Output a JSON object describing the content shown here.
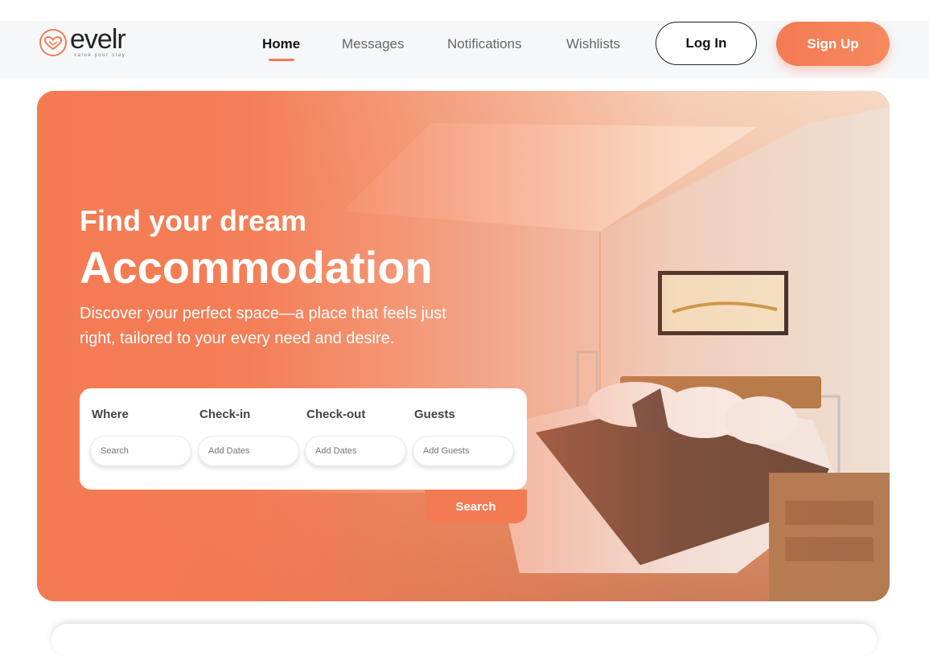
{
  "brand": {
    "name": "evelr",
    "tagline": "value your stay",
    "accent_color": "#f47a52"
  },
  "nav": {
    "items": [
      {
        "label": "Home",
        "active": true
      },
      {
        "label": "Messages",
        "active": false
      },
      {
        "label": "Notifications",
        "active": false
      },
      {
        "label": "Wishlists",
        "active": false
      }
    ],
    "login_label": "Log In",
    "signup_label": "Sign Up"
  },
  "hero": {
    "title_line1": "Find your dream",
    "title_line2": "Accommodation",
    "description": "Discover your perfect space—a place that feels just right, tailored to your every need and desire.",
    "image_icon": "bedroom-photo"
  },
  "search": {
    "fields": [
      {
        "label": "Where",
        "placeholder": "Search"
      },
      {
        "label": "Check-in",
        "placeholder": "Add Dates"
      },
      {
        "label": "Check-out",
        "placeholder": "Add Dates"
      },
      {
        "label": "Guests",
        "placeholder": "Add Guests"
      }
    ],
    "button_label": "Search"
  }
}
